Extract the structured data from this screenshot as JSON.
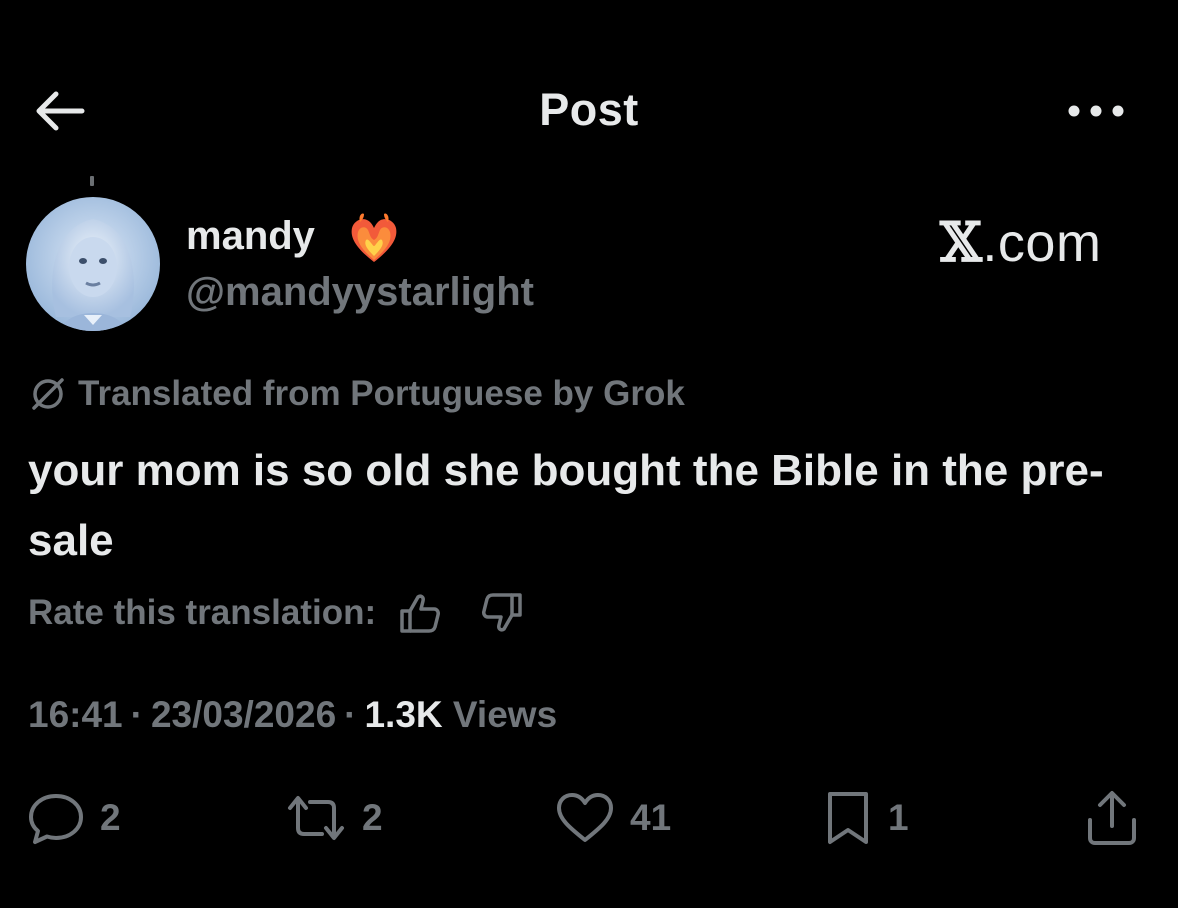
{
  "colors": {
    "background": "#000000",
    "primary_text": "#e7e9ea",
    "secondary_text": "#71767b"
  },
  "header": {
    "title": "Post",
    "back_icon": "arrow-left-icon",
    "more_icon": "more-horizontal-icon"
  },
  "author": {
    "display_name": "mandy",
    "badge_icon": "heart-on-fire-emoji",
    "handle": "@mandyystarlight"
  },
  "watermark": {
    "x_glyph": "𝕏",
    "domain": ".com"
  },
  "translation": {
    "icon": "globe-slash-icon",
    "label": "Translated from Portuguese by Grok",
    "rate_label": "Rate this translation:",
    "thumb_up_icon": "thumbs-up-icon",
    "thumb_down_icon": "thumbs-down-icon"
  },
  "post": {
    "text": "your mom is so old she bought the Bible in the pre-sale"
  },
  "meta": {
    "time": "16:41",
    "date": "23/03/2026",
    "views_count": "1.3K",
    "views_label": "Views",
    "separator": "·"
  },
  "actions": {
    "reply": {
      "icon": "reply-icon",
      "count": "2"
    },
    "repost": {
      "icon": "repost-icon",
      "count": "2"
    },
    "like": {
      "icon": "heart-icon",
      "count": "41"
    },
    "bookmark": {
      "icon": "bookmark-icon",
      "count": "1"
    },
    "share": {
      "icon": "share-icon"
    }
  }
}
